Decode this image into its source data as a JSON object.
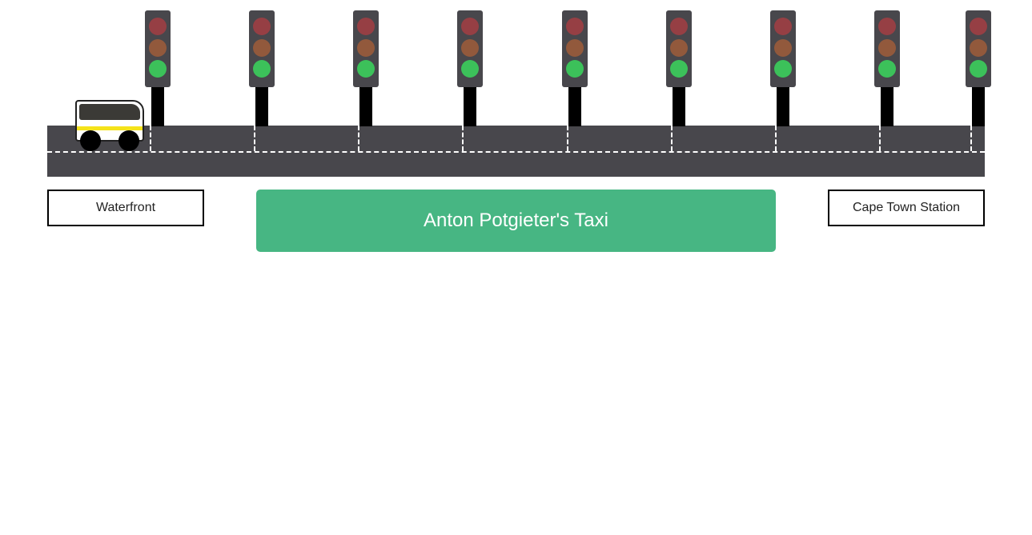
{
  "title": "Anton Potgieter's Taxi",
  "stops": {
    "start": "Waterfront",
    "end": "Cape Town Station"
  },
  "traffic_lights": [
    {
      "state": "green"
    },
    {
      "state": "green"
    },
    {
      "state": "green"
    },
    {
      "state": "green"
    },
    {
      "state": "green"
    },
    {
      "state": "green"
    },
    {
      "state": "green"
    },
    {
      "state": "green"
    },
    {
      "state": "green"
    }
  ],
  "colors": {
    "road": "#48474c",
    "banner": "#47b683",
    "lamp_red_off": "#963f44",
    "lamp_amber_off": "#92593c",
    "lamp_green_on": "#3cc15a",
    "taxi_stripe": "#f5e31a"
  },
  "icons": {
    "vehicle": "minibus-taxi-icon",
    "signal": "traffic-light-icon"
  }
}
